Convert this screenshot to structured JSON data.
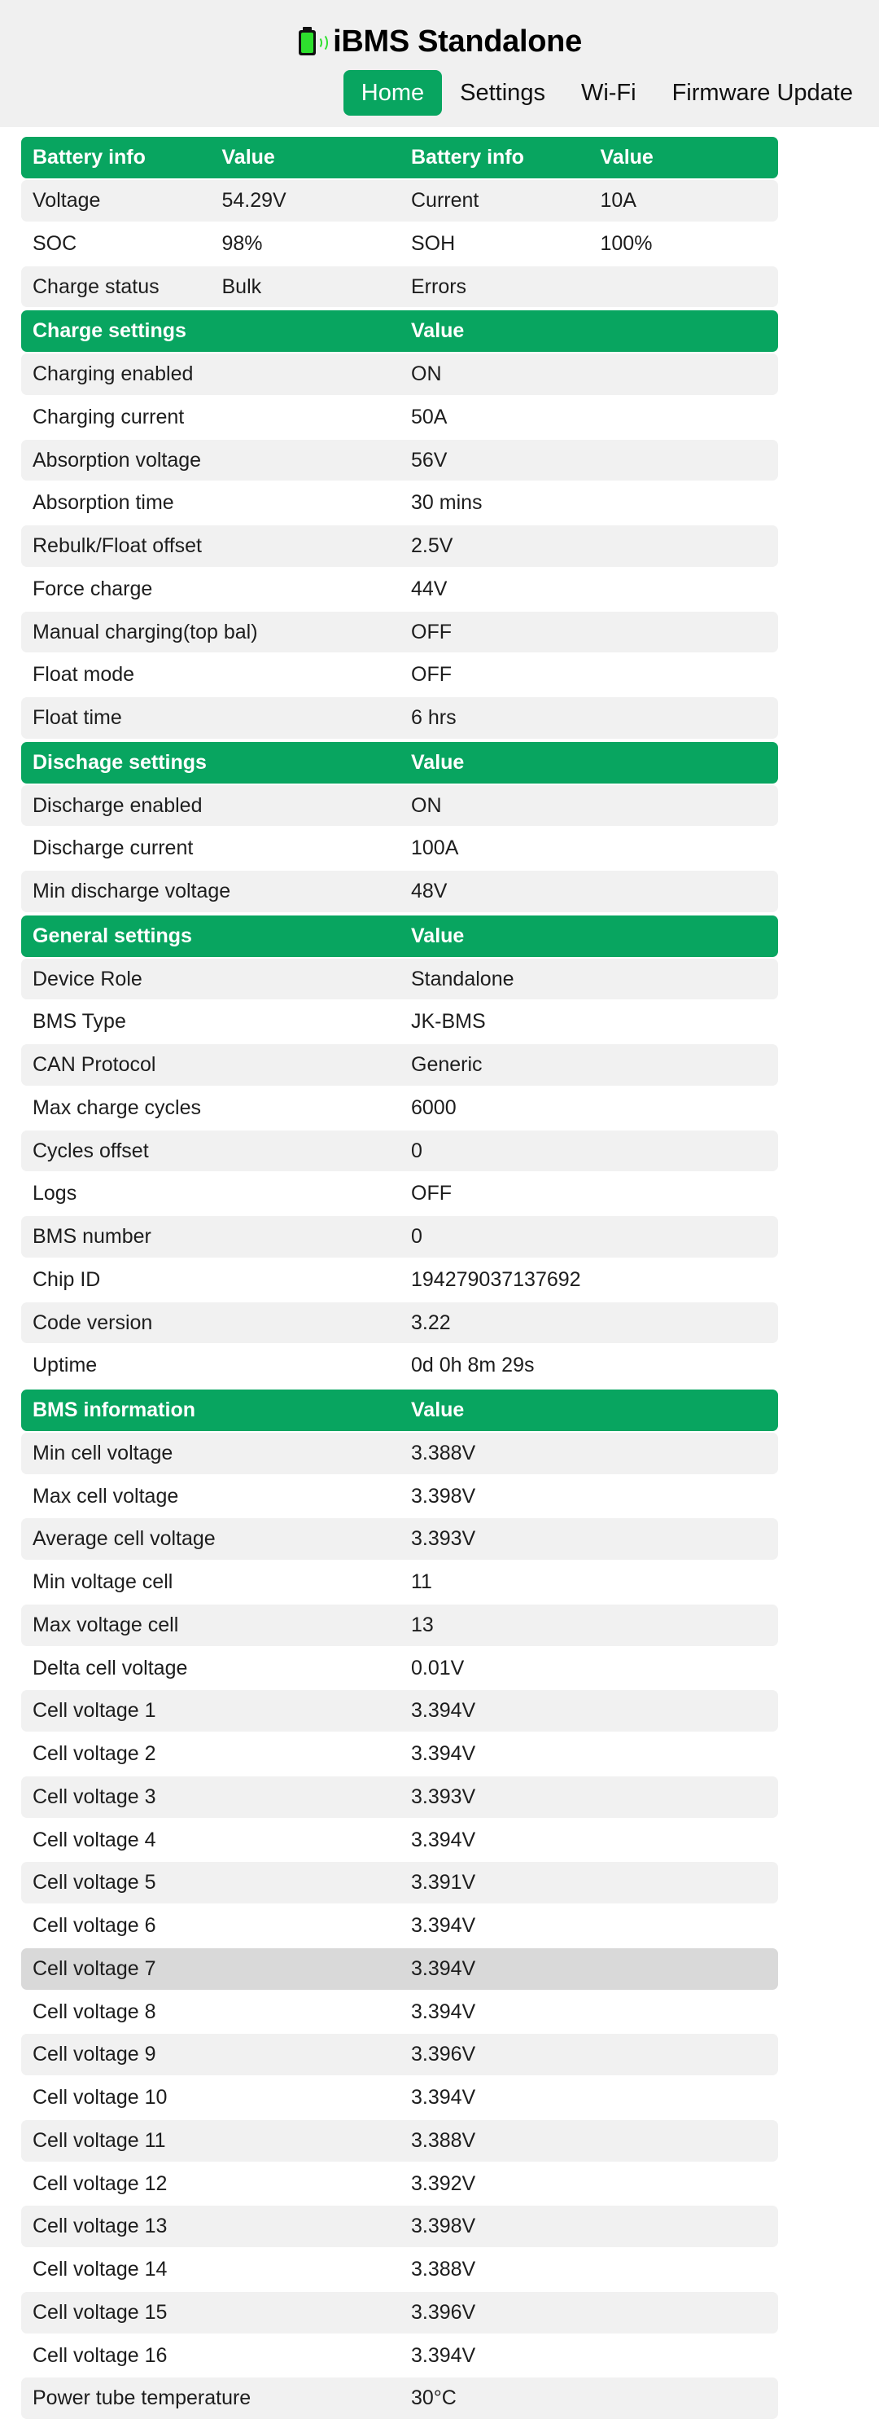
{
  "header": {
    "logo_icon": "battery-signal-icon",
    "title": "iBMS Standalone",
    "accent_color": "#08a560",
    "background_color": "#f0f0f0",
    "nav": [
      {
        "label": "Home",
        "active": true
      },
      {
        "label": "Settings",
        "active": false
      },
      {
        "label": "Wi-Fi",
        "active": false
      },
      {
        "label": "Firmware Update",
        "active": false
      }
    ]
  },
  "battery_info": {
    "headers": [
      "Battery info",
      "Value",
      "Battery info",
      "Value"
    ],
    "rows": [
      [
        "Voltage",
        "54.29V",
        "Current",
        "10A"
      ],
      [
        "SOC",
        "98%",
        "SOH",
        "100%"
      ],
      [
        "Charge status",
        "Bulk",
        "Errors",
        ""
      ]
    ]
  },
  "charge_settings": {
    "headers": [
      "Charge settings",
      "Value"
    ],
    "rows": [
      [
        "Charging enabled",
        "ON"
      ],
      [
        "Charging current",
        "50A"
      ],
      [
        "Absorption voltage",
        "56V"
      ],
      [
        "Absorption time",
        "30 mins"
      ],
      [
        "Rebulk/Float offset",
        "2.5V"
      ],
      [
        "Force charge",
        "44V"
      ],
      [
        "Manual charging(top bal)",
        "OFF"
      ],
      [
        "Float mode",
        "OFF"
      ],
      [
        "Float time",
        "6 hrs"
      ]
    ]
  },
  "discharge_settings": {
    "headers": [
      "Dischage settings",
      "Value"
    ],
    "rows": [
      [
        "Discharge enabled",
        "ON"
      ],
      [
        "Discharge current",
        "100A"
      ],
      [
        "Min discharge voltage",
        "48V"
      ]
    ]
  },
  "general_settings": {
    "headers": [
      "General settings",
      "Value"
    ],
    "rows": [
      [
        "Device Role",
        "Standalone"
      ],
      [
        "BMS Type",
        "JK-BMS"
      ],
      [
        "CAN Protocol",
        "Generic"
      ],
      [
        "Max charge cycles",
        "6000"
      ],
      [
        "Cycles offset",
        "0"
      ],
      [
        "Logs",
        "OFF"
      ],
      [
        "BMS number",
        "0"
      ],
      [
        "Chip ID",
        "194279037137692"
      ],
      [
        "Code version",
        "3.22"
      ],
      [
        "Uptime",
        "0d 0h 8m 29s"
      ]
    ]
  },
  "bms_information": {
    "headers": [
      "BMS information",
      "Value"
    ],
    "highlighted_row_index": 12,
    "rows": [
      [
        "Min cell voltage",
        "3.388V"
      ],
      [
        "Max cell voltage",
        "3.398V"
      ],
      [
        "Average cell voltage",
        "3.393V"
      ],
      [
        "Min voltage cell",
        "11"
      ],
      [
        "Max voltage cell",
        "13"
      ],
      [
        "Delta cell voltage",
        "0.01V"
      ],
      [
        "Cell voltage 1",
        "3.394V"
      ],
      [
        "Cell voltage 2",
        "3.394V"
      ],
      [
        "Cell voltage 3",
        "3.393V"
      ],
      [
        "Cell voltage 4",
        "3.394V"
      ],
      [
        "Cell voltage 5",
        "3.391V"
      ],
      [
        "Cell voltage 6",
        "3.394V"
      ],
      [
        "Cell voltage 7",
        "3.394V"
      ],
      [
        "Cell voltage 8",
        "3.394V"
      ],
      [
        "Cell voltage 9",
        "3.396V"
      ],
      [
        "Cell voltage 10",
        "3.394V"
      ],
      [
        "Cell voltage 11",
        "3.388V"
      ],
      [
        "Cell voltage 12",
        "3.392V"
      ],
      [
        "Cell voltage 13",
        "3.398V"
      ],
      [
        "Cell voltage 14",
        "3.388V"
      ],
      [
        "Cell voltage 15",
        "3.396V"
      ],
      [
        "Cell voltage 16",
        "3.394V"
      ],
      [
        "Power tube temperature",
        "30°C"
      ]
    ]
  }
}
